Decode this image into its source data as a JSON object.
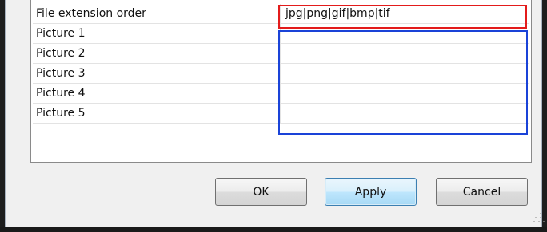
{
  "properties": {
    "rows": [
      {
        "name": "File extension order",
        "value": "jpg|png|gif|bmp|tif"
      },
      {
        "name": "Picture 1",
        "value": ""
      },
      {
        "name": "Picture 2",
        "value": ""
      },
      {
        "name": "Picture 3",
        "value": ""
      },
      {
        "name": "Picture 4",
        "value": ""
      },
      {
        "name": "Picture 5",
        "value": ""
      }
    ]
  },
  "buttons": {
    "ok_label": "OK",
    "apply_label": "Apply",
    "cancel_label": "Cancel"
  },
  "colors": {
    "highlight_red": "#e31b1b",
    "highlight_blue": "#1a43d8",
    "default_button": "#3c7fb1"
  }
}
